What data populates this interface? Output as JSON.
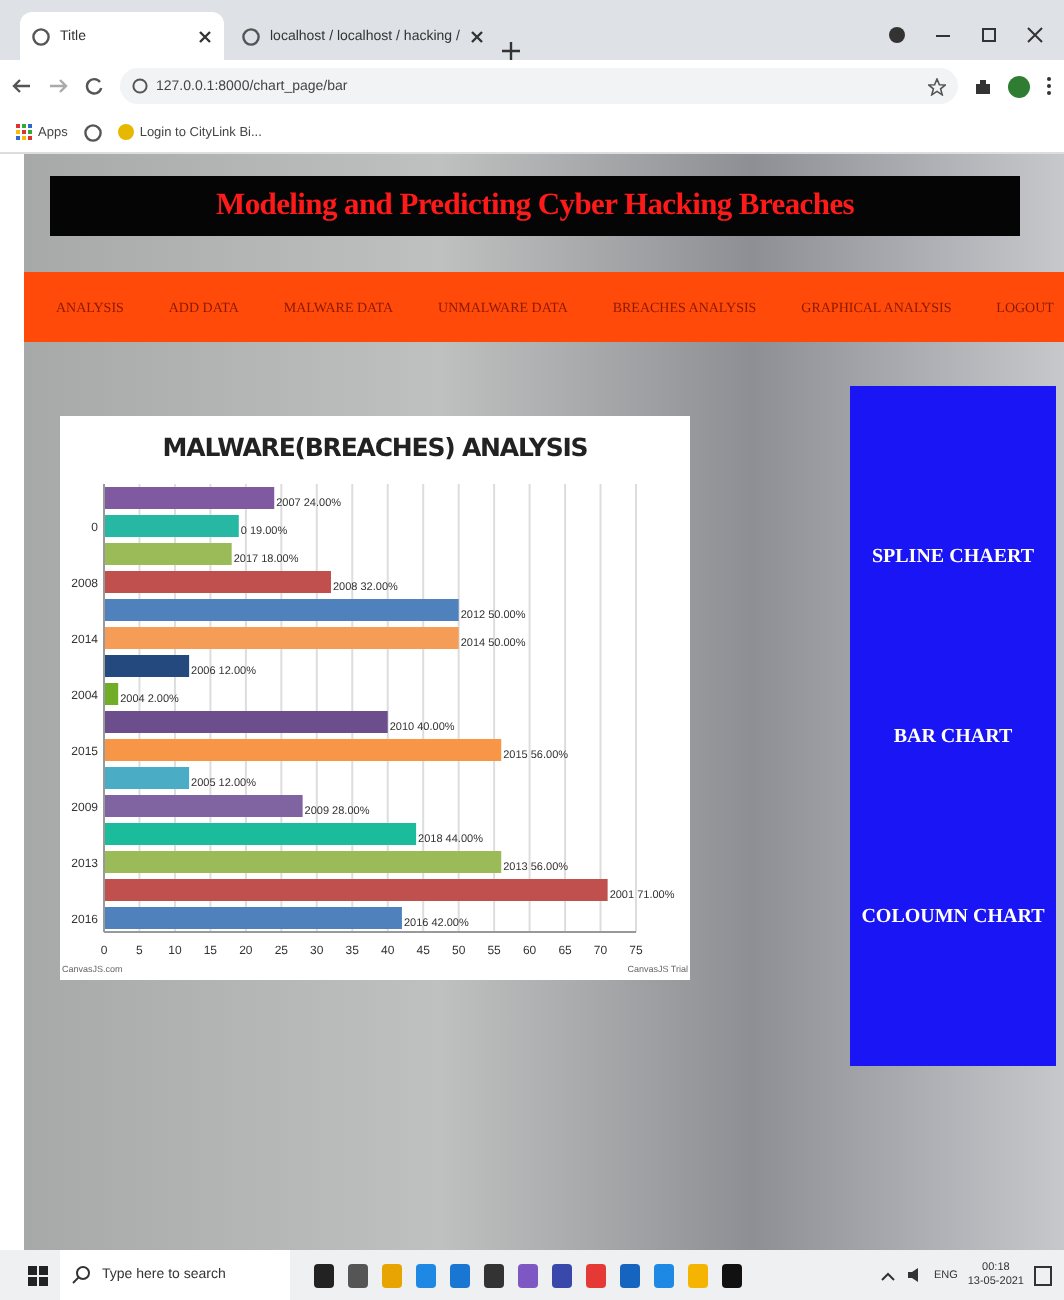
{
  "browser": {
    "tabs": [
      {
        "label": "Title",
        "selected": true
      },
      {
        "label": "localhost / localhost / hacking /",
        "selected": false
      }
    ],
    "url": "127.0.0.1:8000/chart_page/bar",
    "bookmarks": [
      "Apps",
      "Login to CityLink Bi..."
    ]
  },
  "header": {
    "title": "Modeling and Predicting Cyber Hacking Breaches"
  },
  "nav": [
    "ANALYSIS",
    "ADD DATA",
    "MALWARE DATA",
    "UNMALWARE DATA",
    "BREACHES ANALYSIS",
    "GRAPHICAL ANALYSIS",
    "LOGOUT"
  ],
  "chart": {
    "credit": "CanvasJS.com",
    "trial": "CanvasJS Trial",
    "chart_data": {
      "type": "bar",
      "orientation": "horizontal",
      "title": "MALWARE(BREACHES) ANALYSIS",
      "grid": true,
      "series": [
        {
          "values": [
            24,
            19,
            18,
            32,
            50,
            50,
            12,
            2,
            40,
            56,
            12,
            28,
            44,
            56,
            71,
            42
          ],
          "colors": [
            "#7f5aa0",
            "#27b8a4",
            "#9bbb59",
            "#c0504d",
            "#4f81bd",
            "#f59d56",
            "#23497f",
            "#72ad2a",
            "#6d4e8c",
            "#f79647",
            "#4bacc6",
            "#8064a2",
            "#1abc9c",
            "#9bbb59",
            "#c0504d",
            "#4f81bd"
          ]
        }
      ],
      "value_labels": [
        "2007 24.00%",
        "0 19.00%",
        "2017 18.00%",
        "2008 32.00%",
        "2012 50.00%",
        "2014 50.00%",
        "2006 12.00%",
        "2004 2.00%",
        "2010 40.00%",
        "2015 56.00%",
        "2005 12.00%",
        "2009 28.00%",
        "2018 44.00%",
        "2013 56.00%",
        "2001 71.00%",
        "2016 42.00%"
      ],
      "xlim": [
        0,
        75
      ],
      "xticks": [
        0,
        5,
        10,
        15,
        20,
        25,
        30,
        35,
        40,
        45,
        50,
        55,
        60,
        65,
        70,
        75
      ]
    },
    "axis_labels": [
      "0",
      "2008",
      "2014",
      "2004",
      "2015",
      "2009",
      "2013",
      "2016"
    ]
  },
  "side_menu": [
    "SPLINE CHAERT",
    "BAR CHART",
    "COLOUMN CHART"
  ],
  "taskbar": {
    "search_placeholder": "Type here to search",
    "language": "ENG",
    "time": "00:18",
    "date": "13-05-2021"
  }
}
